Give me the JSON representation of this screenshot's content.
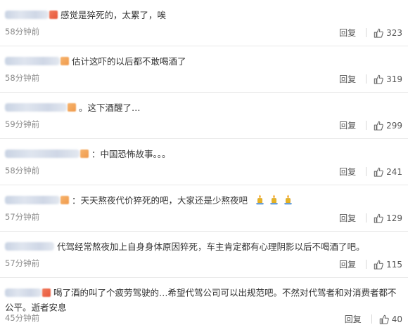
{
  "ui": {
    "reply_label": "回复"
  },
  "comments": [
    {
      "text": "感觉是猝死的，太累了，唉",
      "time": "58分钟前",
      "likes": "323"
    },
    {
      "text": "估计这吓的以后都不敢喝酒了",
      "time": "58分钟前",
      "likes": "319"
    },
    {
      "text": "。这下酒醒了…",
      "time": "59分钟前",
      "likes": "299"
    },
    {
      "text": "：中国恐怖故事。。。",
      "time": "58分钟前",
      "likes": "241"
    },
    {
      "text": "：天天熬夜代价猝死的吧，大家还是少熬夜吧",
      "time": "57分钟前",
      "likes": "129"
    },
    {
      "text": "代驾经常熬夜加上自身身体原因猝死，车主肯定都有心理阴影以后不喝酒了吧。",
      "time": "57分钟前",
      "likes": "115"
    },
    {
      "text": "喝了酒的叫了个疲劳驾驶的…希望代驾公司可以出规范吧。不然对代驾者和对消费者都不公平。逝者安息",
      "time": "45分钟前",
      "likes": "40"
    }
  ],
  "icons": {
    "like": "thumbs-up-icon",
    "emoji": "candle-emoji-icon"
  },
  "colors": {
    "text": "#333333",
    "meta": "#8a8a8a",
    "divider": "#e8e8e8"
  }
}
